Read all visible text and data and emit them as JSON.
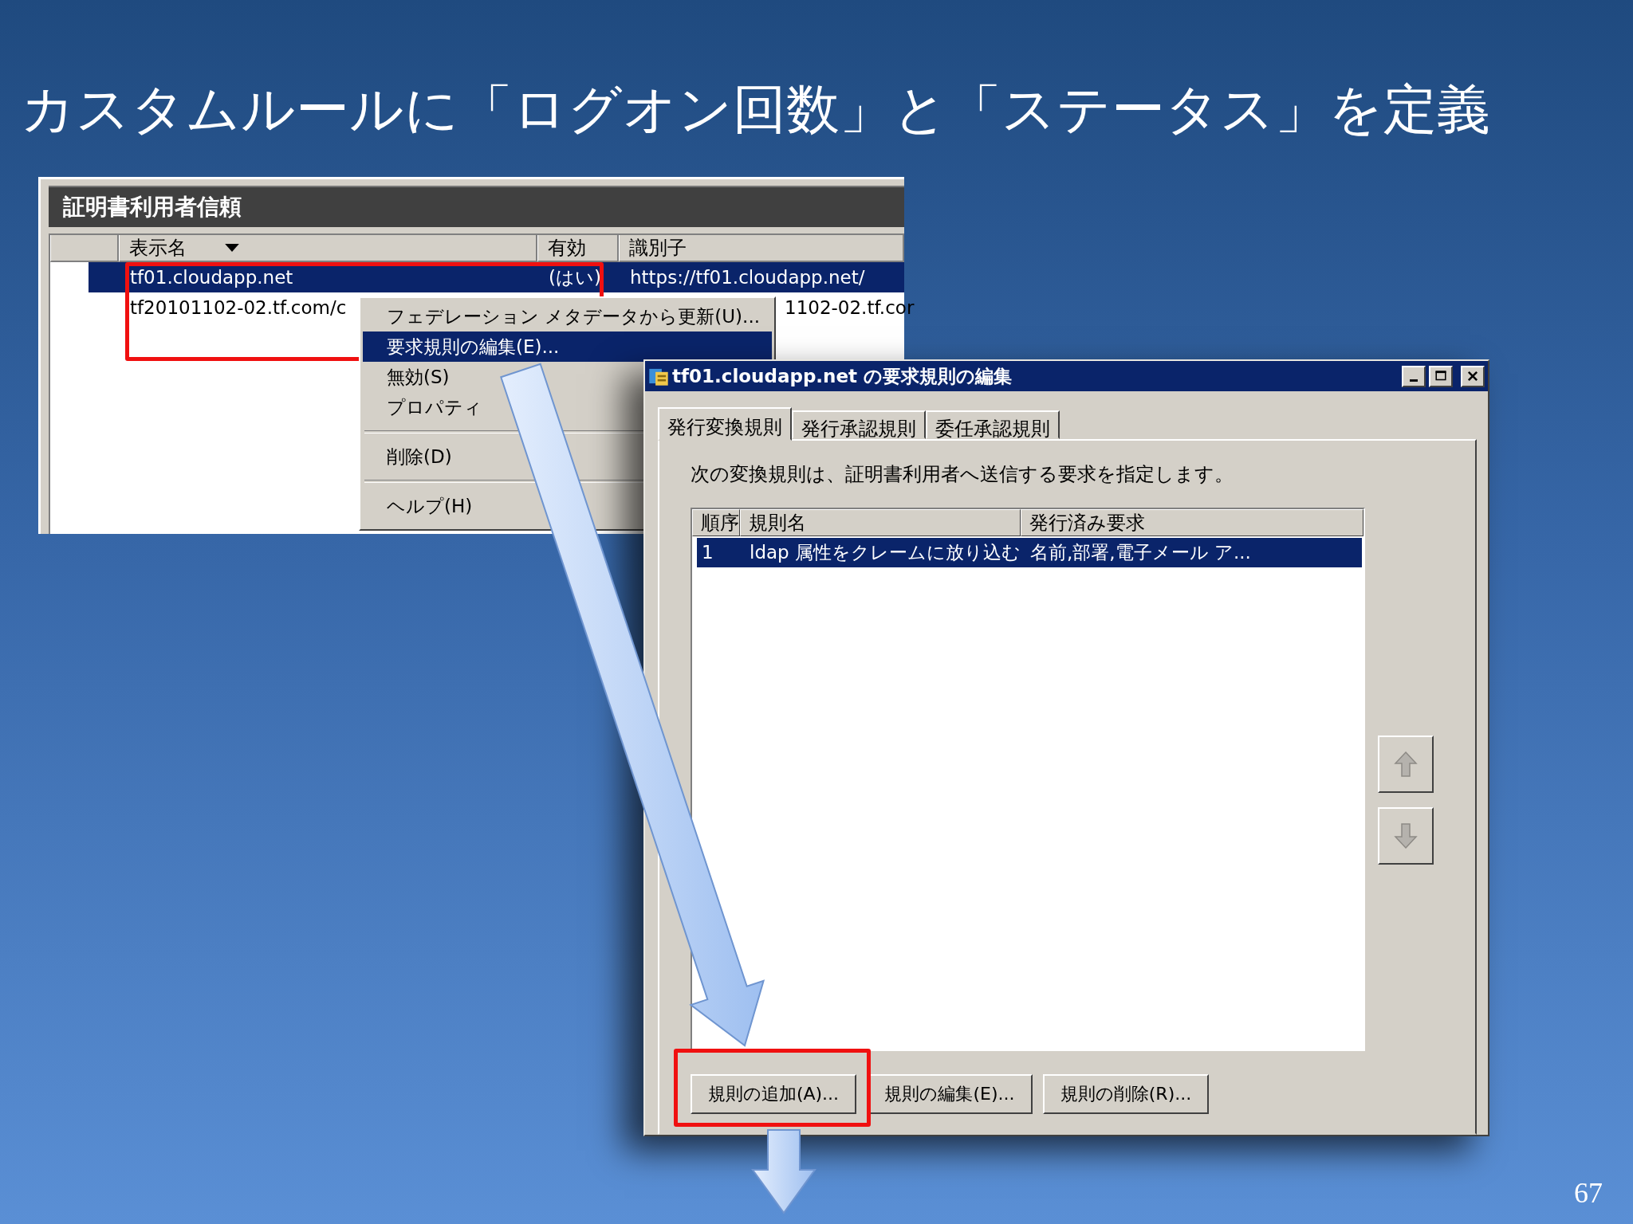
{
  "slide": {
    "title": "カスタムルールに「ログオン回数」と「ステータス」を定義",
    "page_number": "67"
  },
  "trust_window": {
    "title": "証明書利用者信頼",
    "columns": [
      {
        "label": "表示名",
        "sorted": true
      },
      {
        "label": "有効",
        "sorted": false
      },
      {
        "label": "識別子",
        "sorted": false
      }
    ],
    "rows": [
      {
        "display_name": "tf01.cloudapp.net",
        "enabled": "(はい)",
        "identifier": "https://tf01.cloudapp.net/",
        "selected": true
      },
      {
        "display_name": "tf20101102-02.tf.com/c",
        "identifier": "1102-02.tf.cor",
        "selected": false
      }
    ]
  },
  "context_menu": {
    "items": [
      {
        "kind": "item",
        "label": "フェデレーション メタデータから更新(U)...",
        "selected": false
      },
      {
        "kind": "item",
        "label": "要求規則の編集(E)...",
        "selected": true
      },
      {
        "kind": "item",
        "label": "無効(S)",
        "selected": false
      },
      {
        "kind": "item",
        "label": "プロパティ",
        "selected": false
      },
      {
        "kind": "separator"
      },
      {
        "kind": "item",
        "label": "削除(D)",
        "selected": false
      },
      {
        "kind": "separator"
      },
      {
        "kind": "item",
        "label": "ヘルプ(H)",
        "selected": false
      }
    ]
  },
  "dialog": {
    "title": "tf01.cloudapp.net の要求規則の編集",
    "tabs": [
      {
        "label": "発行変換規則",
        "selected": true
      },
      {
        "label": "発行承認規則",
        "selected": false
      },
      {
        "label": "委任承認規則",
        "selected": false
      }
    ],
    "description": "次の変換規則は、証明書利用者へ送信する要求を指定します。",
    "columns": [
      "順序",
      "規則名",
      "発行済み要求"
    ],
    "rows": [
      {
        "cells": [
          "1",
          "ldap 属性をクレームに放り込む",
          "名前,部署,電子メール ア..."
        ],
        "selected": true
      }
    ],
    "buttons": [
      {
        "label": "規則の追加(A)..."
      },
      {
        "label": "規則の編集(E)..."
      },
      {
        "label": "規則の削除(R)..."
      }
    ]
  }
}
